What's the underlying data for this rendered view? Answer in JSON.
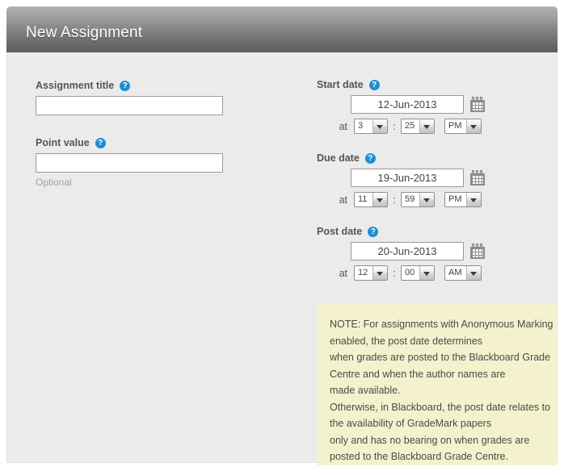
{
  "window": {
    "title": "New Assignment"
  },
  "colors": {
    "header_dark": "#626262",
    "header_light": "#b2b2b2",
    "body_bg": "#ebebeb",
    "help_icon_blue": "#1b8ed6",
    "note_bg": "#f4f2cd"
  },
  "left_column": {
    "assignment_title": {
      "label": "Assignment title",
      "help_glyph": "?",
      "value": "",
      "placeholder": ""
    },
    "point_value": {
      "label": "Point value",
      "help_glyph": "?",
      "value": "",
      "placeholder": "",
      "hint": "Optional"
    }
  },
  "right_column": {
    "start_date": {
      "label": "Start date",
      "help_glyph": "?",
      "date_value": "12-Jun-2013",
      "at_label": "at",
      "hour": "3",
      "separator": ":",
      "minute": "25",
      "meridiem": "PM",
      "calendar_icon": "calendar-icon"
    },
    "due_date": {
      "label": "Due date",
      "help_glyph": "?",
      "date_value": "19-Jun-2013",
      "at_label": "at",
      "hour": "11",
      "separator": ":",
      "minute": "59",
      "meridiem": "PM",
      "calendar_icon": "calendar-icon"
    },
    "post_date": {
      "label": "Post date",
      "help_glyph": "?",
      "date_value": "20-Jun-2013",
      "at_label": "at",
      "hour": "12",
      "separator": ":",
      "minute": "00",
      "meridiem": "AM",
      "calendar_icon": "calendar-icon"
    }
  },
  "note": {
    "lines": [
      "NOTE: For assignments with Anonymous Marking",
      "enabled, the post date determines",
      "when grades are posted to the Blackboard Grade",
      "Centre and when the author names are",
      "made available.",
      "Otherwise, in Blackboard, the post date relates to",
      "the availability of GradeMark papers",
      "only and has no bearing on when grades are",
      "posted to the Blackboard Grade Centre."
    ]
  }
}
